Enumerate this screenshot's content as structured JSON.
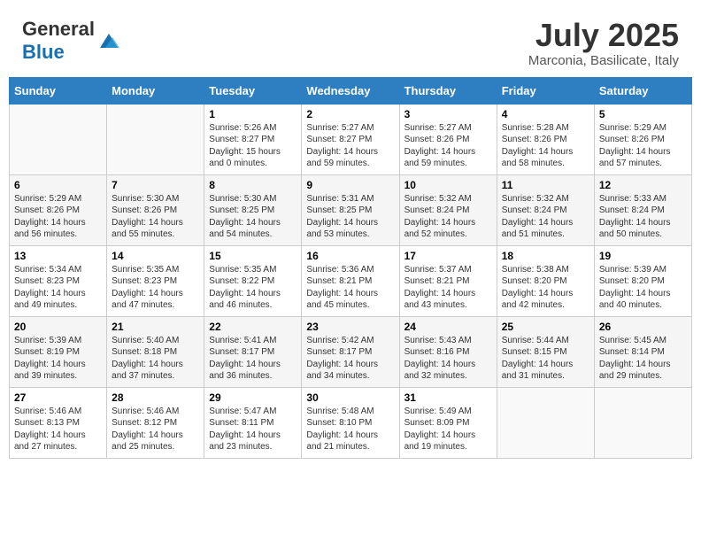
{
  "header": {
    "logo_general": "General",
    "logo_blue": "Blue",
    "month_year": "July 2025",
    "location": "Marconia, Basilicate, Italy"
  },
  "days_of_week": [
    "Sunday",
    "Monday",
    "Tuesday",
    "Wednesday",
    "Thursday",
    "Friday",
    "Saturday"
  ],
  "weeks": [
    [
      {
        "day": "",
        "info": ""
      },
      {
        "day": "",
        "info": ""
      },
      {
        "day": "1",
        "info": "Sunrise: 5:26 AM\nSunset: 8:27 PM\nDaylight: 15 hours and 0 minutes."
      },
      {
        "day": "2",
        "info": "Sunrise: 5:27 AM\nSunset: 8:27 PM\nDaylight: 14 hours and 59 minutes."
      },
      {
        "day": "3",
        "info": "Sunrise: 5:27 AM\nSunset: 8:26 PM\nDaylight: 14 hours and 59 minutes."
      },
      {
        "day": "4",
        "info": "Sunrise: 5:28 AM\nSunset: 8:26 PM\nDaylight: 14 hours and 58 minutes."
      },
      {
        "day": "5",
        "info": "Sunrise: 5:29 AM\nSunset: 8:26 PM\nDaylight: 14 hours and 57 minutes."
      }
    ],
    [
      {
        "day": "6",
        "info": "Sunrise: 5:29 AM\nSunset: 8:26 PM\nDaylight: 14 hours and 56 minutes."
      },
      {
        "day": "7",
        "info": "Sunrise: 5:30 AM\nSunset: 8:26 PM\nDaylight: 14 hours and 55 minutes."
      },
      {
        "day": "8",
        "info": "Sunrise: 5:30 AM\nSunset: 8:25 PM\nDaylight: 14 hours and 54 minutes."
      },
      {
        "day": "9",
        "info": "Sunrise: 5:31 AM\nSunset: 8:25 PM\nDaylight: 14 hours and 53 minutes."
      },
      {
        "day": "10",
        "info": "Sunrise: 5:32 AM\nSunset: 8:24 PM\nDaylight: 14 hours and 52 minutes."
      },
      {
        "day": "11",
        "info": "Sunrise: 5:32 AM\nSunset: 8:24 PM\nDaylight: 14 hours and 51 minutes."
      },
      {
        "day": "12",
        "info": "Sunrise: 5:33 AM\nSunset: 8:24 PM\nDaylight: 14 hours and 50 minutes."
      }
    ],
    [
      {
        "day": "13",
        "info": "Sunrise: 5:34 AM\nSunset: 8:23 PM\nDaylight: 14 hours and 49 minutes."
      },
      {
        "day": "14",
        "info": "Sunrise: 5:35 AM\nSunset: 8:23 PM\nDaylight: 14 hours and 47 minutes."
      },
      {
        "day": "15",
        "info": "Sunrise: 5:35 AM\nSunset: 8:22 PM\nDaylight: 14 hours and 46 minutes."
      },
      {
        "day": "16",
        "info": "Sunrise: 5:36 AM\nSunset: 8:21 PM\nDaylight: 14 hours and 45 minutes."
      },
      {
        "day": "17",
        "info": "Sunrise: 5:37 AM\nSunset: 8:21 PM\nDaylight: 14 hours and 43 minutes."
      },
      {
        "day": "18",
        "info": "Sunrise: 5:38 AM\nSunset: 8:20 PM\nDaylight: 14 hours and 42 minutes."
      },
      {
        "day": "19",
        "info": "Sunrise: 5:39 AM\nSunset: 8:20 PM\nDaylight: 14 hours and 40 minutes."
      }
    ],
    [
      {
        "day": "20",
        "info": "Sunrise: 5:39 AM\nSunset: 8:19 PM\nDaylight: 14 hours and 39 minutes."
      },
      {
        "day": "21",
        "info": "Sunrise: 5:40 AM\nSunset: 8:18 PM\nDaylight: 14 hours and 37 minutes."
      },
      {
        "day": "22",
        "info": "Sunrise: 5:41 AM\nSunset: 8:17 PM\nDaylight: 14 hours and 36 minutes."
      },
      {
        "day": "23",
        "info": "Sunrise: 5:42 AM\nSunset: 8:17 PM\nDaylight: 14 hours and 34 minutes."
      },
      {
        "day": "24",
        "info": "Sunrise: 5:43 AM\nSunset: 8:16 PM\nDaylight: 14 hours and 32 minutes."
      },
      {
        "day": "25",
        "info": "Sunrise: 5:44 AM\nSunset: 8:15 PM\nDaylight: 14 hours and 31 minutes."
      },
      {
        "day": "26",
        "info": "Sunrise: 5:45 AM\nSunset: 8:14 PM\nDaylight: 14 hours and 29 minutes."
      }
    ],
    [
      {
        "day": "27",
        "info": "Sunrise: 5:46 AM\nSunset: 8:13 PM\nDaylight: 14 hours and 27 minutes."
      },
      {
        "day": "28",
        "info": "Sunrise: 5:46 AM\nSunset: 8:12 PM\nDaylight: 14 hours and 25 minutes."
      },
      {
        "day": "29",
        "info": "Sunrise: 5:47 AM\nSunset: 8:11 PM\nDaylight: 14 hours and 23 minutes."
      },
      {
        "day": "30",
        "info": "Sunrise: 5:48 AM\nSunset: 8:10 PM\nDaylight: 14 hours and 21 minutes."
      },
      {
        "day": "31",
        "info": "Sunrise: 5:49 AM\nSunset: 8:09 PM\nDaylight: 14 hours and 19 minutes."
      },
      {
        "day": "",
        "info": ""
      },
      {
        "day": "",
        "info": ""
      }
    ]
  ]
}
